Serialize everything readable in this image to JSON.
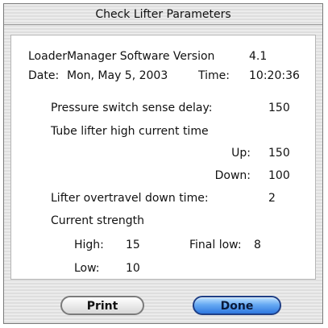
{
  "window": {
    "title": "Check Lifter Parameters"
  },
  "header": {
    "version_label": "LoaderManager Software Version",
    "version_value": "4.1",
    "date_label": "Date:",
    "date_value": "Mon, May 5, 2003",
    "time_label": "Time:",
    "time_value": "10:20:36"
  },
  "params": {
    "pressure_delay_label": "Pressure switch sense delay:",
    "pressure_delay_value": "150",
    "tube_high_current_label": "Tube lifter high current time",
    "up_label": "Up:",
    "up_value": "150",
    "down_label": "Down:",
    "down_value": "100",
    "overtravel_label": "Lifter overtravel down time:",
    "overtravel_value": "2",
    "current_strength_label": "Current strength",
    "high_label": "High:",
    "high_value": "15",
    "final_low_label": "Final low:",
    "final_low_value": "8",
    "low_label": "Low:",
    "low_value": "10"
  },
  "buttons": {
    "print_label": "Print",
    "done_label": "Done"
  }
}
